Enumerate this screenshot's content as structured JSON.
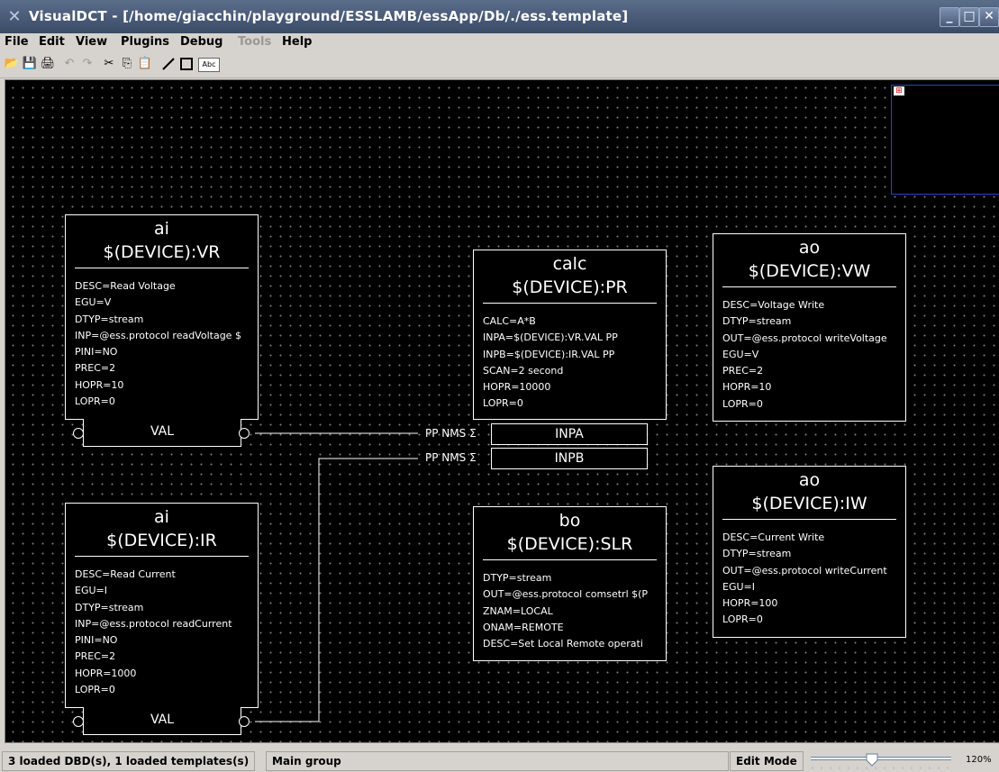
{
  "window": {
    "title": "VisualDCT - [/home/giacchin/playground/ESSLAMB/essApp/Db/./ess.template]",
    "buttons": [
      "_",
      "□",
      "✕"
    ]
  },
  "menu": {
    "file": "File",
    "edit": "Edit",
    "view": "View",
    "plugins": "Plugins",
    "debug": "Debug",
    "tools": "Tools",
    "help": "Help"
  },
  "toolbar": {
    "text_tool_label": "Abc",
    "icons": [
      "open-icon",
      "save-icon",
      "print-icon",
      "undo-icon",
      "redo-icon",
      "cut-icon",
      "copy-icon",
      "paste-icon",
      "line-tool-icon",
      "box-tool-icon",
      "text-tool-icon"
    ]
  },
  "records": {
    "vr": {
      "type": "ai",
      "name": "$(DEVICE):VR",
      "fields": [
        "DESC=Read Voltage",
        "EGU=V",
        "DTYP=stream",
        "INP=@ess.protocol readVoltage $",
        "PINI=NO",
        "PREC=2",
        "HOPR=10",
        "LOPR=0"
      ],
      "out_label": "VAL"
    },
    "ir": {
      "type": "ai",
      "name": "$(DEVICE):IR",
      "fields": [
        "DESC=Read Current",
        "EGU=I",
        "DTYP=stream",
        "INP=@ess.protocol readCurrent",
        "PINI=NO",
        "PREC=2",
        "HOPR=1000",
        "LOPR=0"
      ],
      "out_label": "VAL"
    },
    "pr": {
      "type": "calc",
      "name": "$(DEVICE):PR",
      "fields": [
        "CALC=A*B",
        "INPA=$(DEVICE):VR.VAL PP",
        "INPB=$(DEVICE):IR.VAL PP",
        "SCAN=2 second",
        "HOPR=10000",
        "LOPR=0"
      ],
      "inputs": [
        "INPA",
        "INPB"
      ],
      "input_labels": [
        "PP NMS",
        "PP NMS"
      ]
    },
    "slr": {
      "type": "bo",
      "name": "$(DEVICE):SLR",
      "fields": [
        "DTYP=stream",
        "OUT=@ess.protocol comsetrl $(P",
        "ZNAM=LOCAL",
        "ONAM=REMOTE",
        "DESC=Set Local Remote operati"
      ]
    },
    "vw": {
      "type": "ao",
      "name": "$(DEVICE):VW",
      "fields": [
        "DESC=Voltage Write",
        "DTYP=stream",
        "OUT=@ess.protocol writeVoltage",
        "EGU=V",
        "PREC=2",
        "HOPR=10",
        "LOPR=0"
      ]
    },
    "iw": {
      "type": "ao",
      "name": "$(DEVICE):IW",
      "fields": [
        "DESC=Current Write",
        "DTYP=stream",
        "OUT=@ess.protocol writeCurrent",
        "EGU=I",
        "HOPR=100",
        "LOPR=0"
      ]
    }
  },
  "minimap": {
    "label": "⊞"
  },
  "status": {
    "loaded": "3 loaded DBD(s), 1 loaded templates(s)",
    "group": "Main group",
    "mode": "Edit Mode",
    "zoom": "120%"
  }
}
